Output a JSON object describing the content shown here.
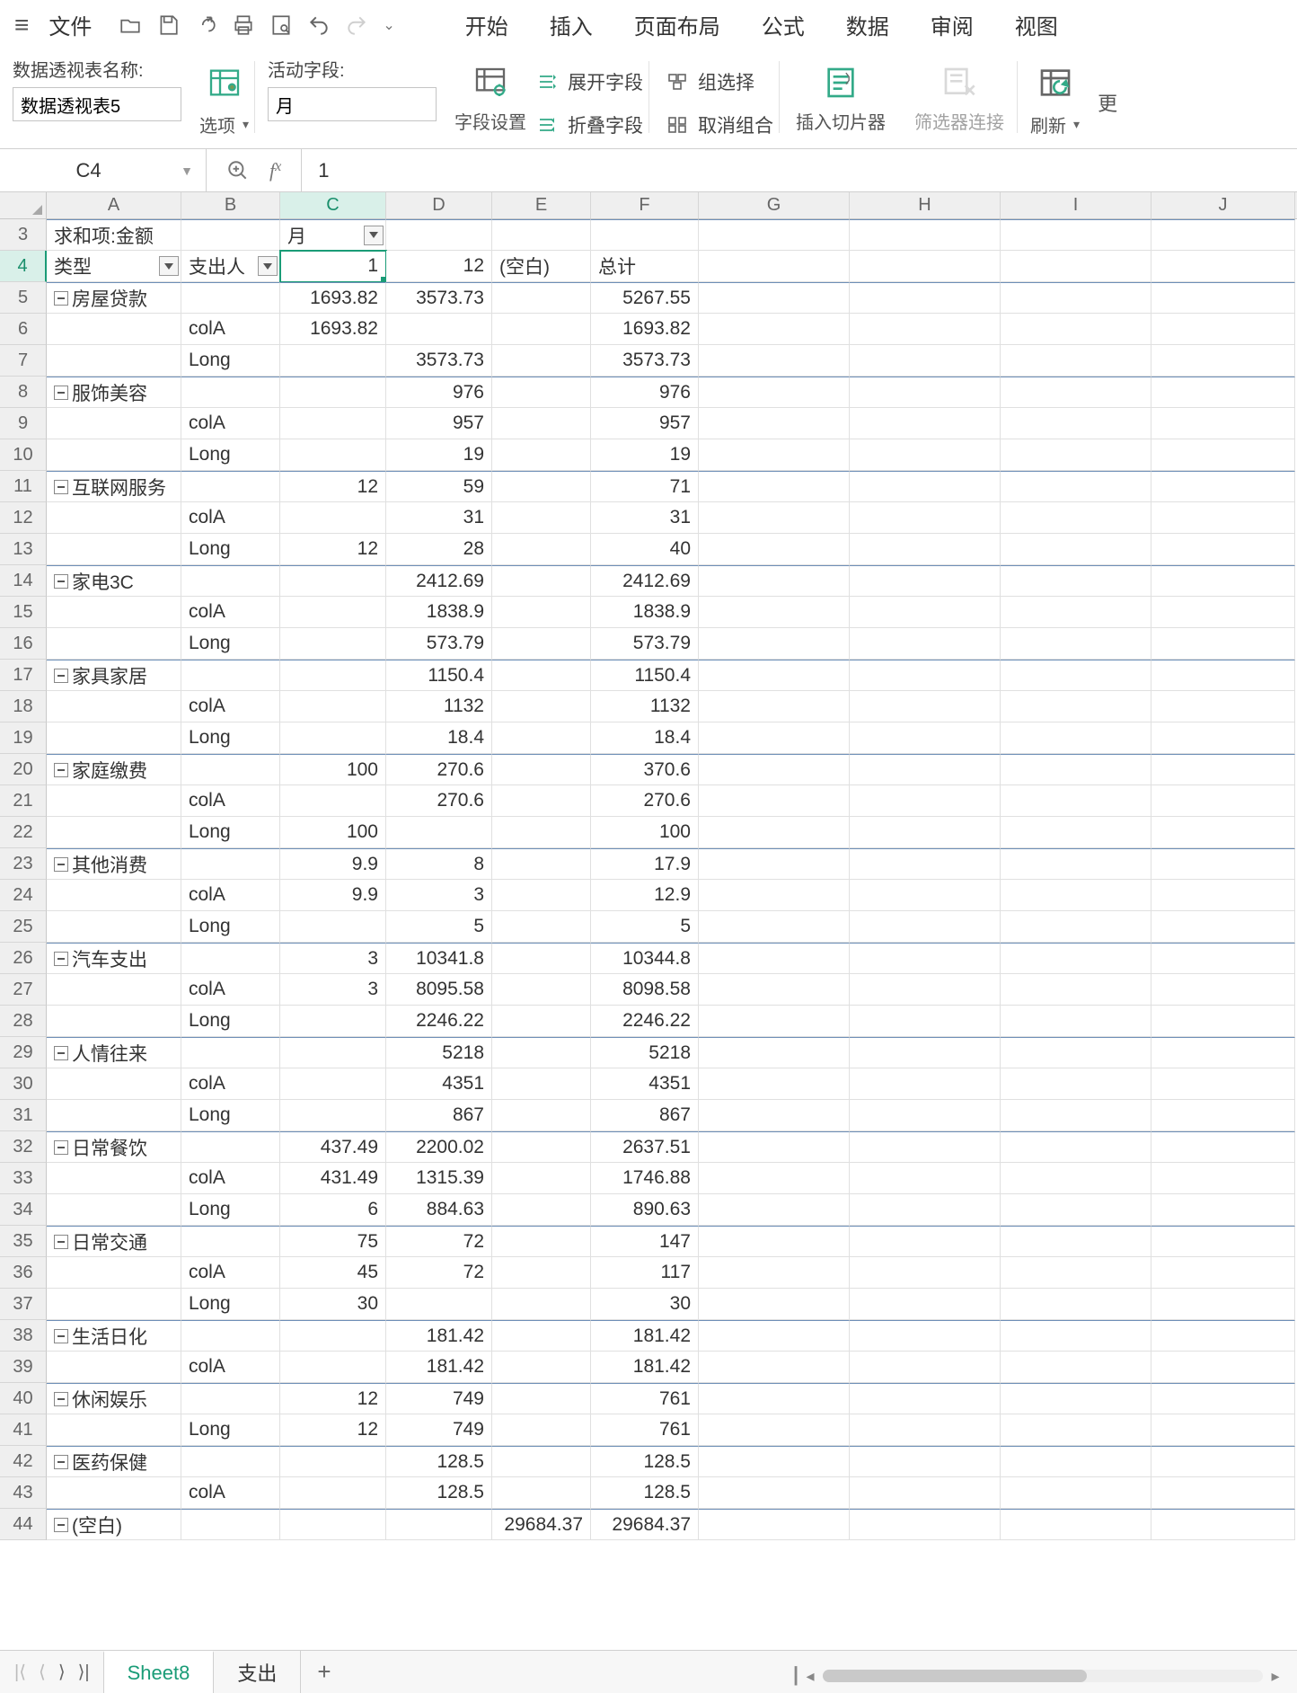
{
  "menu": {
    "file": "文件",
    "tabs": [
      "开始",
      "插入",
      "页面布局",
      "公式",
      "数据",
      "审阅",
      "视图"
    ]
  },
  "ribbon": {
    "pt_name_label": "数据透视表名称:",
    "pt_name_value": "数据透视表5",
    "options_label": "选项",
    "active_field_label": "活动字段:",
    "active_field_value": "月",
    "field_settings": "字段设置",
    "expand_field": "展开字段",
    "collapse_field": "折叠字段",
    "group_select": "组选择",
    "ungroup": "取消组合",
    "insert_slicer": "插入切片器",
    "filter_conn": "筛选器连接",
    "refresh": "刷新",
    "more": "更"
  },
  "fx": {
    "name": "C4",
    "value": "1"
  },
  "columns": [
    "A",
    "B",
    "C",
    "D",
    "E",
    "F",
    "G",
    "H",
    "I",
    "J"
  ],
  "pivot": {
    "r3": {
      "A": "求和项:金额",
      "C": "月"
    },
    "r4": {
      "A": "类型",
      "B": "支出人",
      "C": "1",
      "D": "12",
      "E": "(空白)",
      "F": "总计"
    }
  },
  "rows": [
    {
      "n": 5,
      "exp": true,
      "cat": "房屋贷款",
      "C": "1693.82",
      "D": "3573.73",
      "F": "5267.55",
      "bt": true
    },
    {
      "n": 6,
      "B": "colA",
      "C": "1693.82",
      "F": "1693.82"
    },
    {
      "n": 7,
      "B": "Long",
      "D": "3573.73",
      "F": "3573.73"
    },
    {
      "n": 8,
      "exp": true,
      "cat": "服饰美容",
      "D": "976",
      "F": "976",
      "bt": true
    },
    {
      "n": 9,
      "B": "colA",
      "D": "957",
      "F": "957"
    },
    {
      "n": 10,
      "B": "Long",
      "D": "19",
      "F": "19"
    },
    {
      "n": 11,
      "exp": true,
      "cat": "互联网服务",
      "C": "12",
      "D": "59",
      "F": "71",
      "bt": true
    },
    {
      "n": 12,
      "B": "colA",
      "D": "31",
      "F": "31"
    },
    {
      "n": 13,
      "B": "Long",
      "C": "12",
      "D": "28",
      "F": "40"
    },
    {
      "n": 14,
      "exp": true,
      "cat": "家电3C",
      "D": "2412.69",
      "F": "2412.69",
      "bt": true
    },
    {
      "n": 15,
      "B": "colA",
      "D": "1838.9",
      "F": "1838.9"
    },
    {
      "n": 16,
      "B": "Long",
      "D": "573.79",
      "F": "573.79"
    },
    {
      "n": 17,
      "exp": true,
      "cat": "家具家居",
      "D": "1150.4",
      "F": "1150.4",
      "bt": true
    },
    {
      "n": 18,
      "B": "colA",
      "D": "1132",
      "F": "1132"
    },
    {
      "n": 19,
      "B": "Long",
      "D": "18.4",
      "F": "18.4"
    },
    {
      "n": 20,
      "exp": true,
      "cat": "家庭缴费",
      "C": "100",
      "D": "270.6",
      "F": "370.6",
      "bt": true
    },
    {
      "n": 21,
      "B": "colA",
      "D": "270.6",
      "F": "270.6"
    },
    {
      "n": 22,
      "B": "Long",
      "C": "100",
      "F": "100"
    },
    {
      "n": 23,
      "exp": true,
      "cat": "其他消费",
      "C": "9.9",
      "D": "8",
      "F": "17.9",
      "bt": true
    },
    {
      "n": 24,
      "B": "colA",
      "C": "9.9",
      "D": "3",
      "F": "12.9"
    },
    {
      "n": 25,
      "B": "Long",
      "D": "5",
      "F": "5"
    },
    {
      "n": 26,
      "exp": true,
      "cat": "汽车支出",
      "C": "3",
      "D": "10341.8",
      "F": "10344.8",
      "bt": true
    },
    {
      "n": 27,
      "B": "colA",
      "C": "3",
      "D": "8095.58",
      "F": "8098.58"
    },
    {
      "n": 28,
      "B": "Long",
      "D": "2246.22",
      "F": "2246.22"
    },
    {
      "n": 29,
      "exp": true,
      "cat": "人情往来",
      "D": "5218",
      "F": "5218",
      "bt": true
    },
    {
      "n": 30,
      "B": "colA",
      "D": "4351",
      "F": "4351"
    },
    {
      "n": 31,
      "B": "Long",
      "D": "867",
      "F": "867"
    },
    {
      "n": 32,
      "exp": true,
      "cat": "日常餐饮",
      "C": "437.49",
      "D": "2200.02",
      "F": "2637.51",
      "bt": true
    },
    {
      "n": 33,
      "B": "colA",
      "C": "431.49",
      "D": "1315.39",
      "F": "1746.88"
    },
    {
      "n": 34,
      "B": "Long",
      "C": "6",
      "D": "884.63",
      "F": "890.63"
    },
    {
      "n": 35,
      "exp": true,
      "cat": "日常交通",
      "C": "75",
      "D": "72",
      "F": "147",
      "bt": true
    },
    {
      "n": 36,
      "B": "colA",
      "C": "45",
      "D": "72",
      "F": "117"
    },
    {
      "n": 37,
      "B": "Long",
      "C": "30",
      "F": "30"
    },
    {
      "n": 38,
      "exp": true,
      "cat": "生活日化",
      "D": "181.42",
      "F": "181.42",
      "bt": true
    },
    {
      "n": 39,
      "B": "colA",
      "D": "181.42",
      "F": "181.42"
    },
    {
      "n": 40,
      "exp": true,
      "cat": "休闲娱乐",
      "C": "12",
      "D": "749",
      "F": "761",
      "bt": true
    },
    {
      "n": 41,
      "B": "Long",
      "C": "12",
      "D": "749",
      "F": "761"
    },
    {
      "n": 42,
      "exp": true,
      "cat": "医药保健",
      "D": "128.5",
      "F": "128.5",
      "bt": true
    },
    {
      "n": 43,
      "B": "colA",
      "D": "128.5",
      "F": "128.5"
    },
    {
      "n": 44,
      "exp": true,
      "cat": "(空白)",
      "E": "29684.37",
      "F": "29684.37",
      "bt": true
    }
  ],
  "sheets": {
    "active": "Sheet8",
    "other": "支出"
  }
}
